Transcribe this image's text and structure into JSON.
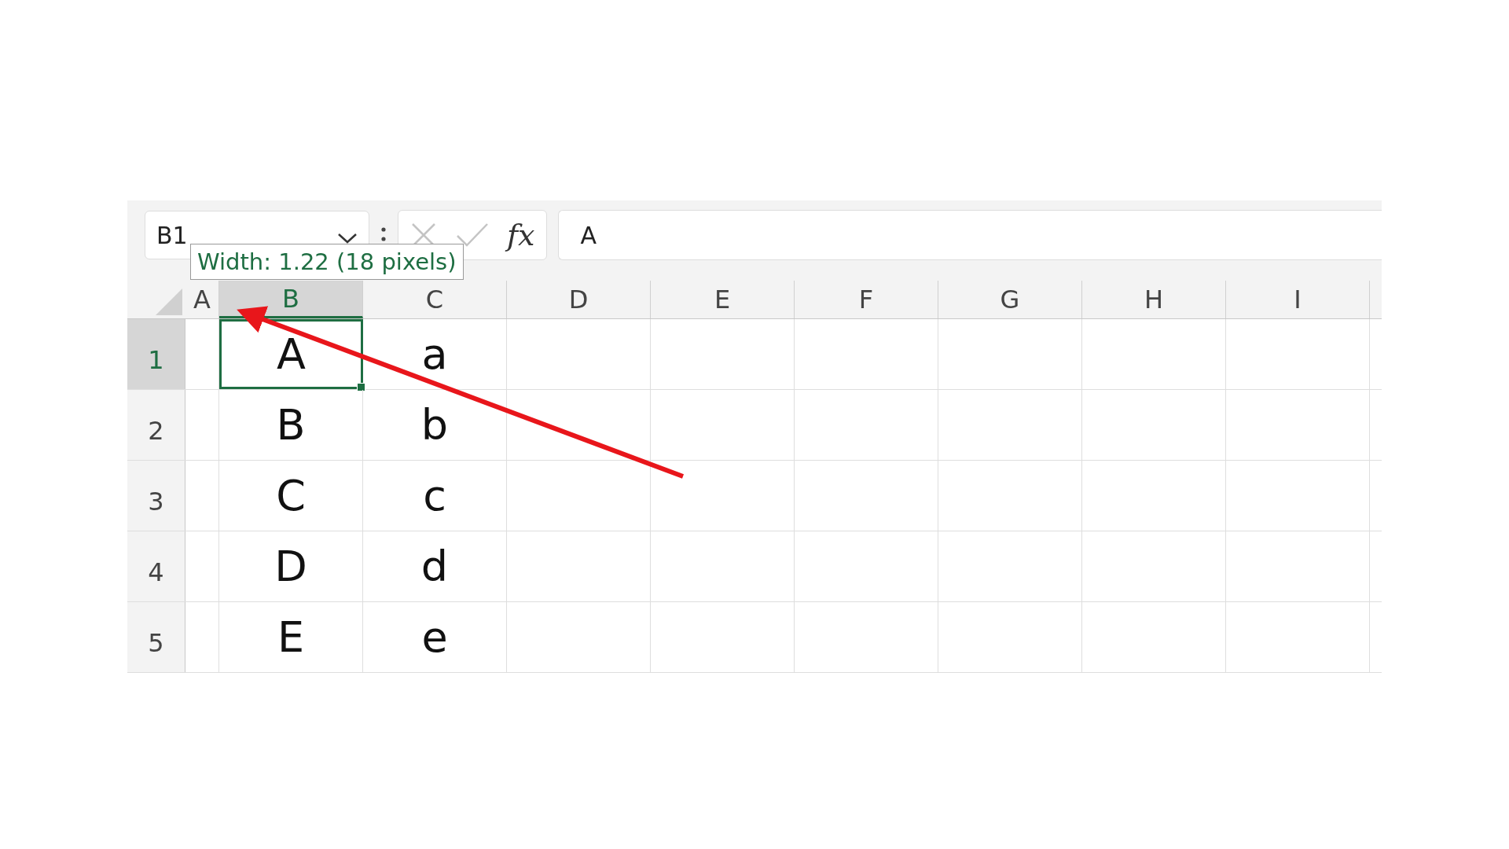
{
  "name_box": {
    "value": "B1"
  },
  "formula_bar": {
    "function_label": "fx",
    "value": "A"
  },
  "tooltip": {
    "text": "Width: 1.22 (18 pixels)"
  },
  "columns": [
    {
      "label": "A",
      "selected": false,
      "kind": "narrow"
    },
    {
      "label": "B",
      "selected": true,
      "kind": "wide"
    },
    {
      "label": "C",
      "selected": false,
      "kind": "wide"
    },
    {
      "label": "D",
      "selected": false,
      "kind": "wide"
    },
    {
      "label": "E",
      "selected": false,
      "kind": "wide"
    },
    {
      "label": "F",
      "selected": false,
      "kind": "wide"
    },
    {
      "label": "G",
      "selected": false,
      "kind": "wide"
    },
    {
      "label": "H",
      "selected": false,
      "kind": "wide"
    },
    {
      "label": "I",
      "selected": false,
      "kind": "wide"
    }
  ],
  "rows": [
    {
      "label": "1",
      "selected": true,
      "column_b": "A",
      "column_c": "a"
    },
    {
      "label": "2",
      "selected": false,
      "column_b": "B",
      "column_c": "b"
    },
    {
      "label": "3",
      "selected": false,
      "column_b": "C",
      "column_c": "c"
    },
    {
      "label": "4",
      "selected": false,
      "column_b": "D",
      "column_c": "d"
    },
    {
      "label": "5",
      "selected": false,
      "column_b": "E",
      "column_c": "e"
    }
  ]
}
